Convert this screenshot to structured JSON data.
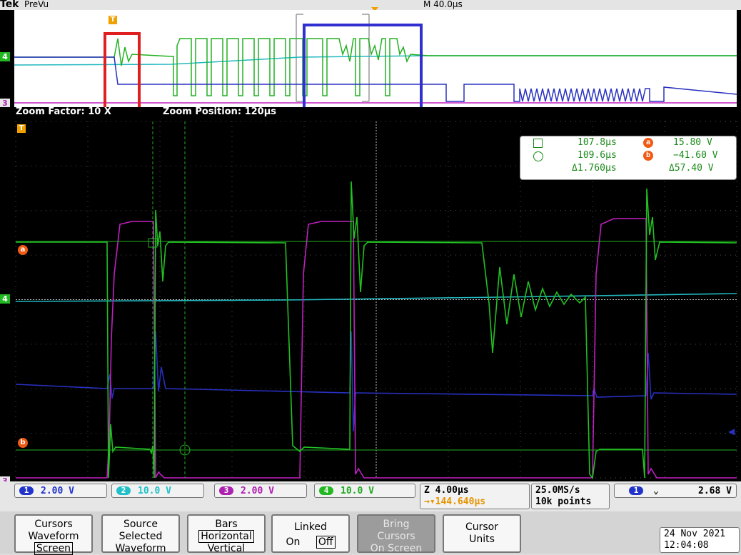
{
  "header": {
    "brand": "Tek",
    "mode": "PreVu",
    "timebase": "M 40.0µs"
  },
  "zoom": {
    "factor_label": "Zoom Factor: 10 X",
    "position_label": "Zoom Position: 120µs"
  },
  "channel_markers": {
    "ch4": "4",
    "ch3": "3",
    "ref_a": "a",
    "ref_b": "b",
    "trigger": "T"
  },
  "readout": {
    "cursor1_time": "107.8µs",
    "cursor2_time": "109.6µs",
    "delta_time": "Δ1.760µs",
    "cursor_a_volts": "15.80 V",
    "cursor_b_volts": "−41.60 V",
    "delta_volts": "Δ57.40 V",
    "label_a": "a",
    "label_b": "b"
  },
  "channels": [
    {
      "num": "1",
      "scale": "2.00 V",
      "color": "#2233cc"
    },
    {
      "num": "2",
      "scale": "10.0 V",
      "color": "#22c0c8"
    },
    {
      "num": "3",
      "scale": "2.00 V",
      "color": "#b020b0"
    },
    {
      "num": "4",
      "scale": "10.0 V",
      "color": "#22b822"
    }
  ],
  "zoom_info": {
    "scale": "Z 4.00µs",
    "trigger_pos": "→▾144.640µs"
  },
  "acq": {
    "rate": "25.0MS/s",
    "points": "10k points"
  },
  "trigger": {
    "source": "1",
    "slope": "⌄",
    "level": "2.68 V"
  },
  "softkeys": {
    "cursors": [
      "Cursors",
      "Waveform",
      "Screen"
    ],
    "source": [
      "Source",
      "Selected",
      "Waveform"
    ],
    "bars": [
      "Bars",
      "Horizontal",
      "Vertical"
    ],
    "linked": [
      "Linked",
      "On",
      "Off"
    ],
    "bring": [
      "Bring",
      "Cursors",
      "On Screen"
    ],
    "units": [
      "Cursor",
      "Units"
    ]
  },
  "datetime": {
    "date": "24 Nov 2021",
    "time": "12:04:08"
  },
  "colors": {
    "green": "#22c022",
    "cyan": "#22b8c0",
    "blue": "#2830c0",
    "magenta": "#c020c0",
    "orange": "#f05a14",
    "red_box": "#e02020",
    "blue_box": "#3030d0"
  }
}
